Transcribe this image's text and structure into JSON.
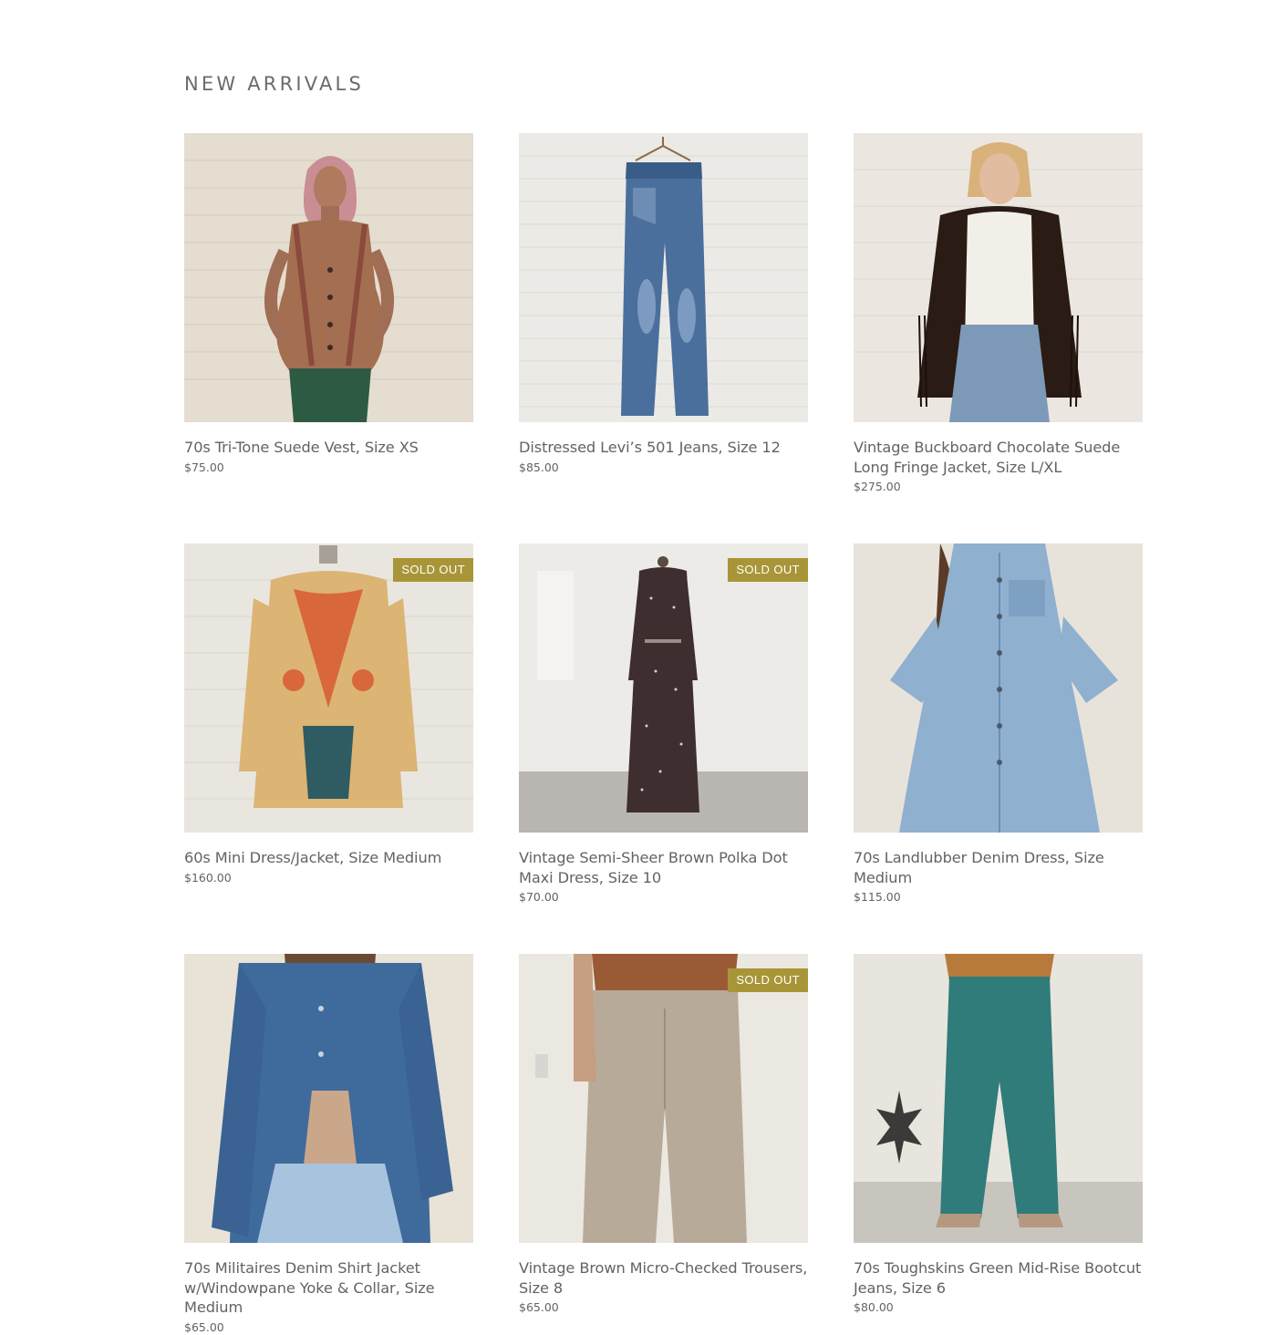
{
  "section": {
    "title": "NEW ARRIVALS"
  },
  "products": [
    {
      "title": "70s Tri-Tone Suede Vest, Size XS",
      "price": "$75.00",
      "sold_out": false,
      "image": "model in tan suede vest and green pants against white brick wall"
    },
    {
      "title": "Distressed Levi’s 501 Jeans, Size 12",
      "price": "$85.00",
      "sold_out": false,
      "image": "faded blue jeans on hanger against white brick wall"
    },
    {
      "title": "Vintage Buckboard Chocolate Suede Long Fringe Jacket, Size L/XL",
      "price": "$275.00",
      "sold_out": false,
      "image": "model in brown fringe jacket, white tee and jeans"
    },
    {
      "title": "60s Mini Dress/Jacket, Size Medium",
      "price": "$160.00",
      "sold_out": true,
      "image": "printed orange and gold dress on dress form"
    },
    {
      "title": "Vintage Semi-Sheer Brown Polka Dot Maxi Dress, Size 10",
      "price": "$70.00",
      "sold_out": true,
      "image": "brown polka dot maxi dress on dress form"
    },
    {
      "title": "70s Landlubber Denim Dress, Size Medium",
      "price": "$115.00",
      "sold_out": false,
      "image": "model in light blue denim dress"
    },
    {
      "title": "70s Militaires Denim Shirt Jacket w/Windowpane Yoke & Collar, Size Medium",
      "price": "$65.00",
      "sold_out": false,
      "image": "model in denim shirt jacket and ripped jeans"
    },
    {
      "title": "Vintage Brown Micro-Checked Trousers, Size 8",
      "price": "$65.00",
      "sold_out": true,
      "image": "beige checked trousers with suede vest"
    },
    {
      "title": "70s Toughskins Green Mid-Rise Bootcut Jeans, Size 6",
      "price": "$80.00",
      "sold_out": false,
      "image": "teal bootcut jeans with cowboy boots"
    }
  ],
  "badge_label": "SOLD OUT",
  "colors": {
    "badge": "#a89537",
    "text": "#636363",
    "wall": "#e8e4dc"
  }
}
